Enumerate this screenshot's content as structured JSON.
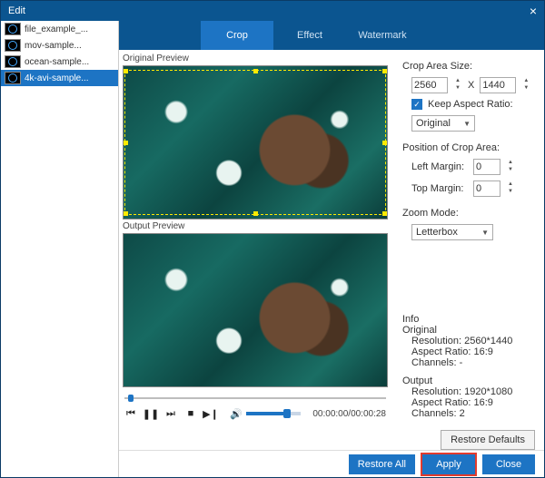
{
  "window": {
    "title": "Edit"
  },
  "filelist": {
    "items": [
      {
        "name": "file_example_..."
      },
      {
        "name": "mov-sample..."
      },
      {
        "name": "ocean-sample..."
      },
      {
        "name": "4k-avi-sample..."
      }
    ],
    "selected_index": 3
  },
  "tabs": {
    "items": [
      {
        "label": "Crop"
      },
      {
        "label": "Effect"
      },
      {
        "label": "Watermark"
      }
    ],
    "active_index": 0
  },
  "preview": {
    "original_label": "Original Preview",
    "output_label": "Output Preview"
  },
  "transport": {
    "timecode": "00:00:00/00:00:28"
  },
  "crop": {
    "size_label": "Crop Area Size:",
    "width": "2560",
    "height": "1440",
    "x_sep": "X",
    "keep_ar_label": "Keep Aspect Ratio:",
    "keep_ar_checked": true,
    "ar_select": "Original",
    "pos_label": "Position of Crop Area:",
    "left_label": "Left Margin:",
    "left_value": "0",
    "top_label": "Top Margin:",
    "top_value": "0",
    "zoom_label": "Zoom Mode:",
    "zoom_select": "Letterbox"
  },
  "info": {
    "title": "Info",
    "original": {
      "title": "Original",
      "resolution": "Resolution: 2560*1440",
      "aspect": "Aspect Ratio: 16:9",
      "channels": "Channels: -"
    },
    "output": {
      "title": "Output",
      "resolution": "Resolution: 1920*1080",
      "aspect": "Aspect Ratio: 16:9",
      "channels": "Channels: 2"
    }
  },
  "buttons": {
    "restore_defaults": "Restore Defaults",
    "restore_all": "Restore All",
    "apply": "Apply",
    "close": "Close"
  }
}
